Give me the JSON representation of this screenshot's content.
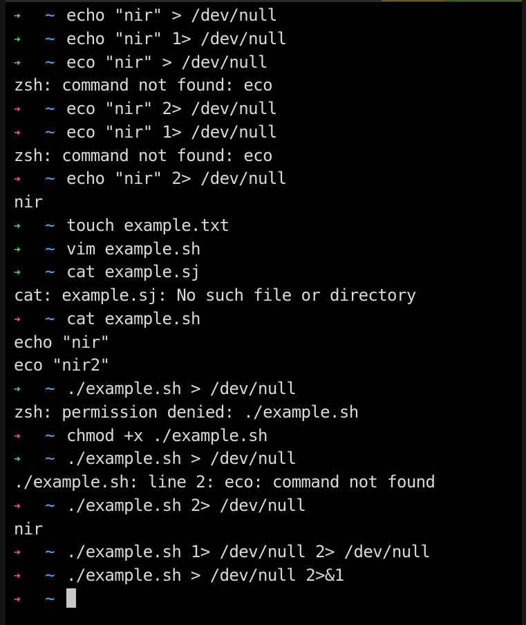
{
  "terminal": {
    "prompt_dir": "~",
    "colors": {
      "ok_arrow": "#5fd75f",
      "error_arrow": "#ff5f5f",
      "directory": "#52a8ff",
      "text": "#d9d9d9",
      "background": "#000000"
    },
    "lines": [
      {
        "kind": "prompt",
        "status": "ok",
        "text": "echo \"nir\" > /dev/null"
      },
      {
        "kind": "prompt",
        "status": "ok",
        "text": "echo \"nir\" 1> /dev/null"
      },
      {
        "kind": "prompt",
        "status": "ok",
        "text": "eco \"nir\" > /dev/null"
      },
      {
        "kind": "output",
        "text": "zsh: command not found: eco"
      },
      {
        "kind": "prompt",
        "status": "error",
        "text": "eco \"nir\" 2> /dev/null"
      },
      {
        "kind": "prompt",
        "status": "error",
        "text": "eco \"nir\" 1> /dev/null"
      },
      {
        "kind": "output",
        "text": "zsh: command not found: eco"
      },
      {
        "kind": "prompt",
        "status": "error",
        "text": "echo \"nir\" 2> /dev/null"
      },
      {
        "kind": "output",
        "text": "nir"
      },
      {
        "kind": "prompt",
        "status": "ok",
        "text": "touch example.txt"
      },
      {
        "kind": "prompt",
        "status": "ok",
        "text": "vim example.sh"
      },
      {
        "kind": "prompt",
        "status": "ok",
        "text": "cat example.sj"
      },
      {
        "kind": "output",
        "text": "cat: example.sj: No such file or directory"
      },
      {
        "kind": "prompt",
        "status": "error",
        "text": "cat example.sh"
      },
      {
        "kind": "output",
        "text": "echo \"nir\""
      },
      {
        "kind": "output",
        "text": "eco \"nir2\""
      },
      {
        "kind": "prompt",
        "status": "ok",
        "text": "./example.sh > /dev/null"
      },
      {
        "kind": "output",
        "text": "zsh: permission denied: ./example.sh"
      },
      {
        "kind": "prompt",
        "status": "error",
        "text": "chmod +x ./example.sh"
      },
      {
        "kind": "prompt",
        "status": "ok",
        "text": "./example.sh > /dev/null"
      },
      {
        "kind": "output",
        "text": "./example.sh: line 2: eco: command not found"
      },
      {
        "kind": "prompt",
        "status": "error",
        "text": "./example.sh 2> /dev/null"
      },
      {
        "kind": "output",
        "text": "nir"
      },
      {
        "kind": "prompt",
        "status": "error",
        "text": "./example.sh 1> /dev/null 2> /dev/null"
      },
      {
        "kind": "prompt",
        "status": "error",
        "text": "./example.sh > /dev/null 2>&1"
      },
      {
        "kind": "prompt",
        "status": "error",
        "text": "",
        "cursor": true
      }
    ]
  }
}
